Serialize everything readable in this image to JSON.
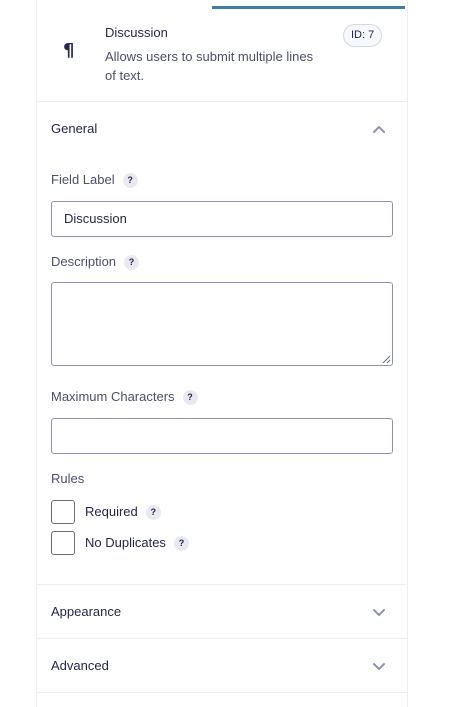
{
  "field": {
    "icon": "pilcrow-icon",
    "title": "Discussion",
    "description": "Allows users to submit multiple lines of text.",
    "id_badge": "ID: 7"
  },
  "sections": {
    "general": {
      "title": "General",
      "expanded": true,
      "field_label": {
        "label": "Field Label",
        "help": "?",
        "value": "Discussion"
      },
      "description": {
        "label": "Description",
        "help": "?",
        "value": ""
      },
      "max_chars": {
        "label": "Maximum Characters",
        "help": "?",
        "value": ""
      },
      "rules": {
        "label": "Rules",
        "required": {
          "label": "Required",
          "help": "?",
          "checked": false
        },
        "no_duplicates": {
          "label": "No Duplicates",
          "help": "?",
          "checked": false
        }
      }
    },
    "appearance": {
      "title": "Appearance",
      "expanded": false
    },
    "advanced": {
      "title": "Advanced",
      "expanded": false
    }
  },
  "colors": {
    "accent": "#3e7da6",
    "text": "#242748",
    "border": "#9092b2",
    "chevron": "#9092b2"
  }
}
